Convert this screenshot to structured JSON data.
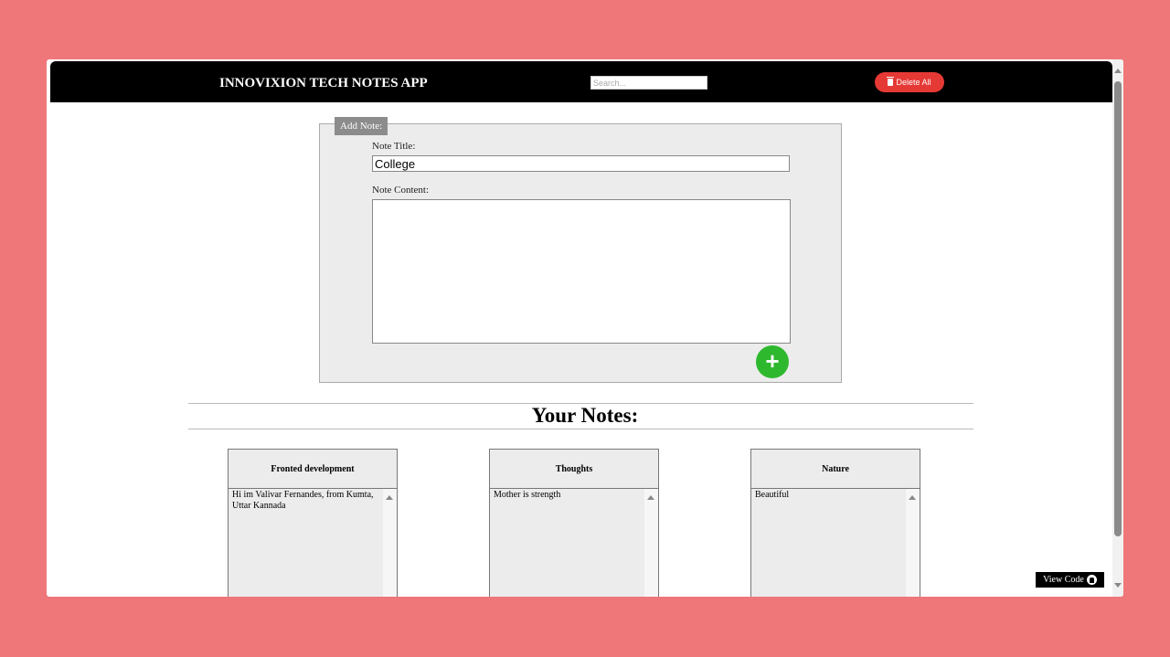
{
  "header": {
    "title": "INNOVIXION TECH NOTES APP",
    "search_placeholder": "Search...",
    "delete_all_label": "Delete All"
  },
  "add_note": {
    "legend": "Add Note:",
    "title_label": "Note Title:",
    "title_value": "College",
    "content_label": "Note Content:",
    "content_value": "",
    "add_button_symbol": "+"
  },
  "notes_section": {
    "heading": "Your Notes:",
    "notes": [
      {
        "title": "Fronted development",
        "content": "Hi im Valivar Fernandes, from Kumta, Uttar Kannada"
      },
      {
        "title": "Thoughts",
        "content": "Mother is strength"
      },
      {
        "title": "Nature",
        "content": "Beautiful"
      }
    ]
  },
  "footer": {
    "view_code_label": "View Code"
  },
  "colors": {
    "background": "#ef7779",
    "header": "#000000",
    "delete_button": "#e53935",
    "add_button": "#2eb82e"
  }
}
